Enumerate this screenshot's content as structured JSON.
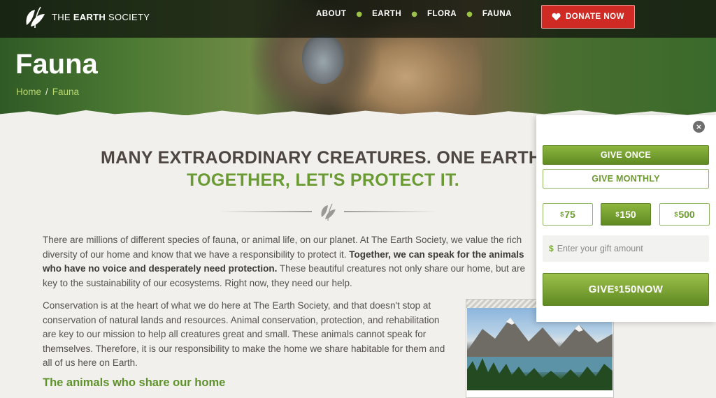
{
  "header": {
    "brand_prefix": "THE",
    "brand_bold": "EARTH",
    "brand_suffix": "SOCIETY",
    "nav": [
      "ABOUT",
      "EARTH",
      "FLORA",
      "FAUNA"
    ],
    "donate_label": "DONATE NOW"
  },
  "hero": {
    "title": "Fauna",
    "breadcrumb": [
      "Home",
      "Fauna"
    ],
    "breadcrumb_separator": "/"
  },
  "main": {
    "headline_line1": "MANY EXTRAORDINARY CREATURES. ONE EARTH.",
    "headline_line2": "TOGETHER, LET'S PROTECT IT.",
    "paragraph1_part1": "There are millions of different species of fauna, or animal life, on our planet. At The Earth Society, we value the rich diversity of our home and know that we have a responsibility to protect it. ",
    "paragraph1_bold": "Together, we can speak for the animals who have no voice and desperately need protection.",
    "paragraph1_part2": " These beautiful creatures not only share our home, but are key to the sustainability of our ecosystems. Right now, they need our help.",
    "paragraph2": "Conservation is at the heart of what we do here at The Earth Society, and that doesn't stop at conservation of natural lands and resources. Animal conservation, protection, and rehabilitation are key to our mission to help all creatures great and small. These animals cannot speak for themselves. Therefore, it is our responsibility to make the home we share habitable for them and all of us here on Earth.",
    "subheading": "The animals who share our home"
  },
  "donate_widget": {
    "close_symbol": "×",
    "give_once": "GIVE ONCE",
    "give_monthly": "GIVE MONTHLY",
    "currency": "$",
    "amounts": [
      "75",
      "150",
      "500"
    ],
    "selected_amount": "150",
    "gift_placeholder": "Enter your gift amount",
    "give_button_prefix": "GIVE ",
    "give_button_suffix": " NOW"
  },
  "colors": {
    "accent_green": "#6a9a32",
    "donate_red": "#cf2b24",
    "text_dark": "#4d4641"
  },
  "icons": [
    "leaf-logo-icon",
    "heart-icon",
    "leaf-divider-icon",
    "close-icon"
  ]
}
